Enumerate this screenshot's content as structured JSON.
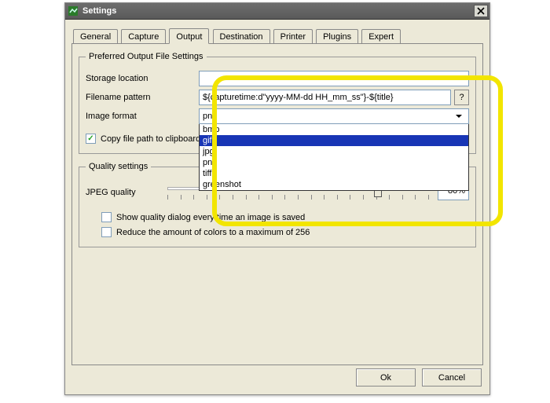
{
  "window": {
    "title": "Settings"
  },
  "tabs": [
    "General",
    "Capture",
    "Output",
    "Destination",
    "Printer",
    "Plugins",
    "Expert"
  ],
  "activeTab": "Output",
  "fileSettings": {
    "legend": "Preferred Output File Settings",
    "storageLabel": "Storage location",
    "filenameLabel": "Filename pattern",
    "filenamePattern": "${capturetime:d\"yyyy-MM-dd HH_mm_ss\"}-${title}",
    "helpBtn": "?",
    "formatLabel": "Image format",
    "formatSelected": "png",
    "formatOptions": [
      "bmp",
      "gif",
      "jpg",
      "png",
      "tiff",
      "greenshot"
    ],
    "formatHighlighted": "gif",
    "clipboardChecked": true,
    "clipboardLabel": "Copy file path to clipboard every time an image is saved"
  },
  "quality": {
    "legend": "Quality settings",
    "jpegLabel": "JPEG quality",
    "jpegValue": "80%",
    "jpegPercent": 80,
    "showDialogChecked": false,
    "showDialogLabel": "Show quality dialog every time an image is saved",
    "reduceColorsChecked": false,
    "reduceColorsLabel": "Reduce the amount of colors to a maximum of 256"
  },
  "buttons": {
    "ok": "Ok",
    "cancel": "Cancel"
  }
}
